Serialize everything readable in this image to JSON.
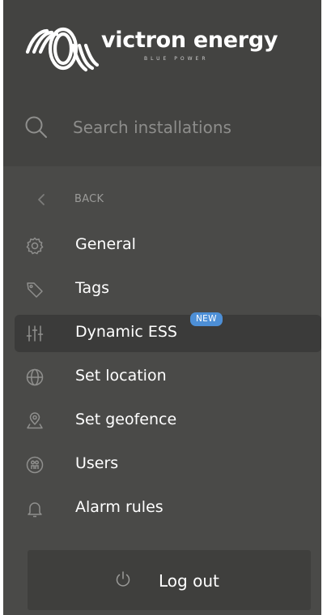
{
  "brand": {
    "name": "victron energy",
    "tagline": "BLUE POWER"
  },
  "search": {
    "placeholder": "Search installations",
    "value": ""
  },
  "back": {
    "label": "BACK"
  },
  "menu": {
    "items": [
      {
        "label": "General",
        "icon": "gear-icon"
      },
      {
        "label": "Tags",
        "icon": "tag-icon"
      },
      {
        "label": "Dynamic ESS",
        "icon": "sliders-icon",
        "badge": "NEW",
        "active": true
      },
      {
        "label": "Set location",
        "icon": "globe-icon"
      },
      {
        "label": "Set geofence",
        "icon": "geofence-pin-icon"
      },
      {
        "label": "Users",
        "icon": "users-icon"
      },
      {
        "label": "Alarm rules",
        "icon": "bell-icon"
      }
    ]
  },
  "logout": {
    "label": "Log out"
  },
  "colors": {
    "panel": "#4a4a48",
    "header": "#434341",
    "active_row": "#3b3b3a",
    "badge": "#4d8fd6",
    "icon": "#8f8f8d"
  }
}
